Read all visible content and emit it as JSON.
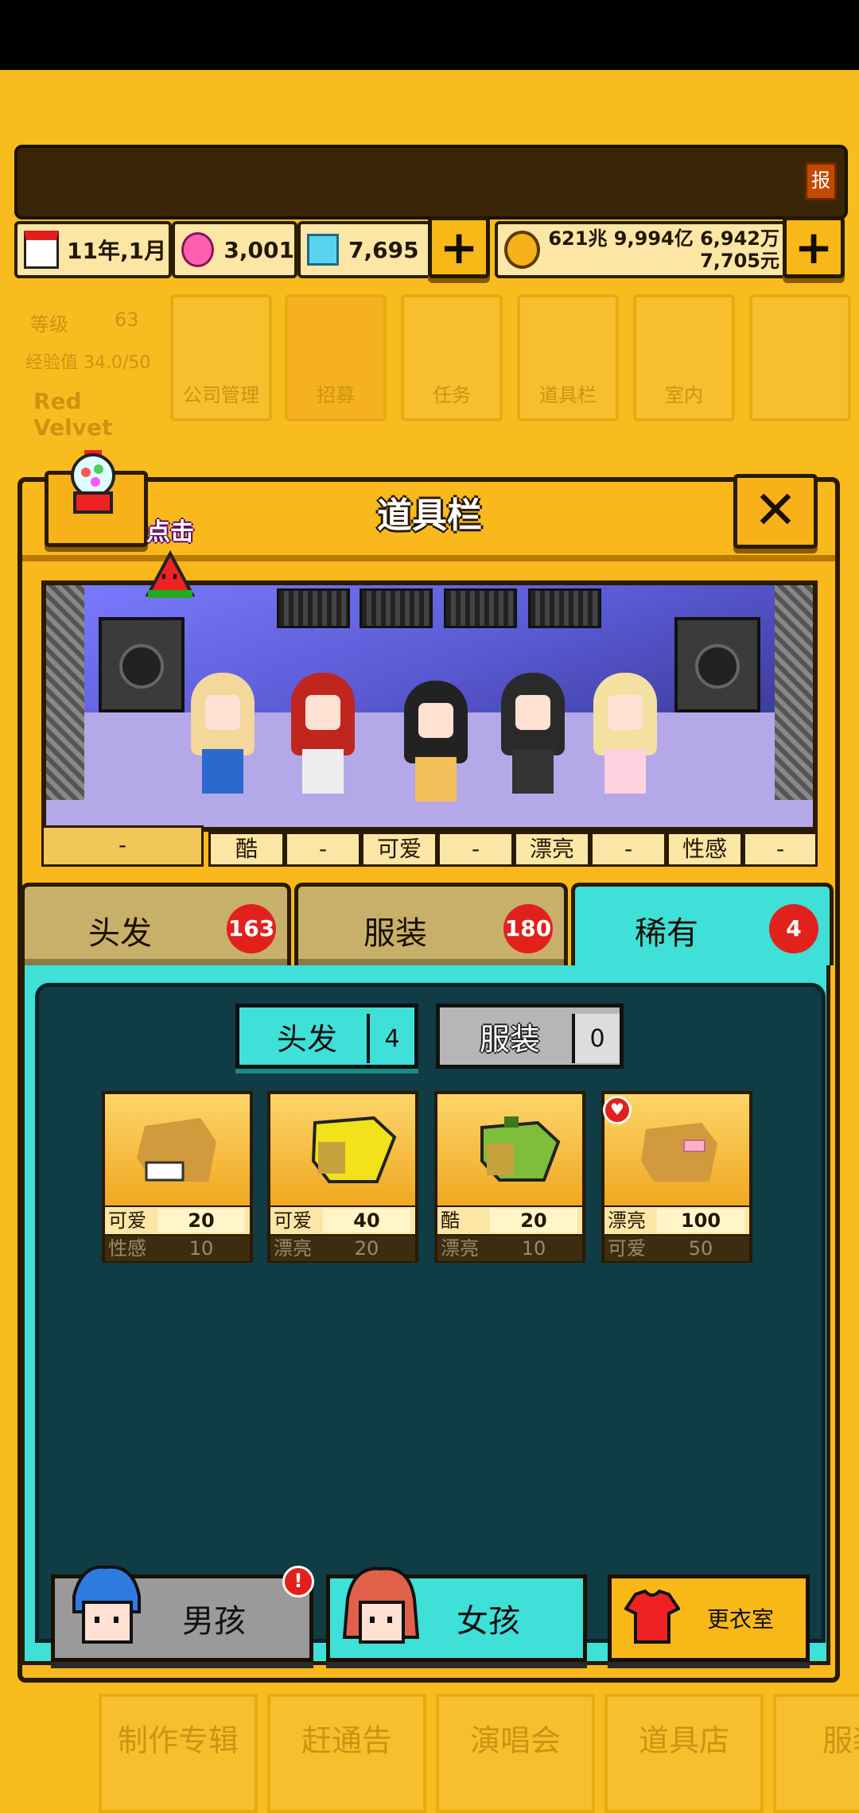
{
  "header": {
    "date": "11年,1月",
    "gems": "3,001",
    "diamonds": "7,695",
    "money_line1": "621兆 9,994亿 6,942万",
    "money_line2": "7,705元",
    "report_label": "报"
  },
  "background_menu": {
    "level_label": "等级",
    "level_value": "63",
    "exp_label": "经验值 34.0/50",
    "group_name": "Red Velvet",
    "tiles": [
      "公司管理",
      "招募",
      "任务",
      "道具栏",
      "室内"
    ]
  },
  "panel": {
    "title": "道具栏",
    "click_hint": "点击",
    "close_symbol": "✕"
  },
  "attributes": [
    "-",
    "酷",
    "-",
    "可爱",
    "-",
    "漂亮",
    "-",
    "性感",
    "-"
  ],
  "tabs": [
    {
      "label": "头发",
      "count": "163"
    },
    {
      "label": "服装",
      "count": "180"
    },
    {
      "label": "稀有",
      "count": "4"
    }
  ],
  "subtabs": [
    {
      "label": "头发",
      "count": "4"
    },
    {
      "label": "服装",
      "count": "0"
    }
  ],
  "items": [
    {
      "stat1_name": "可爱",
      "stat1_value": "20",
      "stat2_name": "性感",
      "stat2_value": "10"
    },
    {
      "stat1_name": "可爱",
      "stat1_value": "40",
      "stat2_name": "漂亮",
      "stat2_value": "20"
    },
    {
      "stat1_name": "酷",
      "stat1_value": "20",
      "stat2_name": "漂亮",
      "stat2_value": "10"
    },
    {
      "stat1_name": "漂亮",
      "stat1_value": "100",
      "stat2_name": "可爱",
      "stat2_value": "50"
    }
  ],
  "bottom_buttons": {
    "boys": "男孩",
    "girls": "女孩",
    "wardrobe": "更衣室",
    "alert": "!"
  },
  "bottom_bg_menu": [
    "制作专辑",
    "赶通告",
    "演唱会",
    "道具店",
    "服装"
  ],
  "colors": {
    "background": "#f9bc1e",
    "accent_cyan": "#3ee0d8",
    "content_dark": "#0f3c45",
    "badge_red": "#e2211c"
  }
}
